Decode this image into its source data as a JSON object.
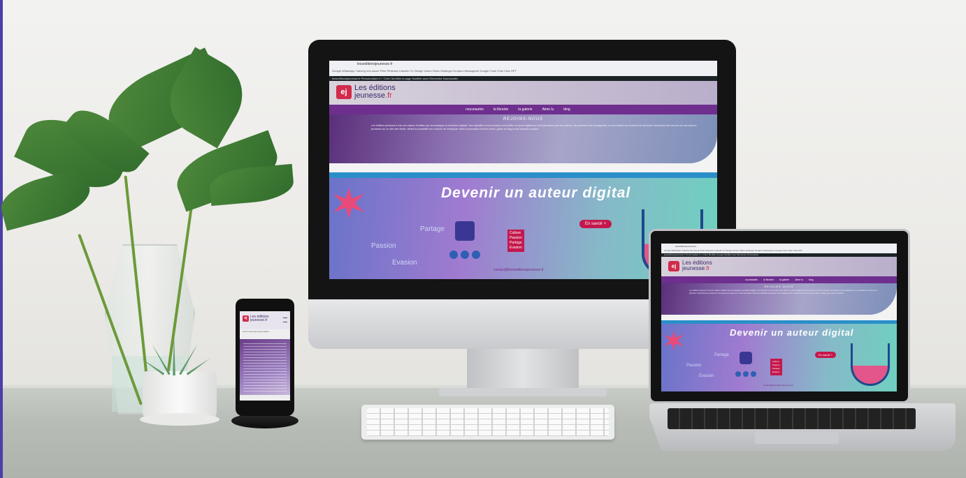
{
  "desktop_site": {
    "url": "lesseditionsjeunesse.fr",
    "bookmarks": "Google  WhatsApp  Training  Vos savoir  Pinte  Pinterest  LinkedIn  Trr Design  Vimeo Vidéo  Hostinger  Dropbox  Messagerie  Google Fonts  Todo  Chat GPT",
    "admin_bar": "lesseditionsjeunesse.fr   Personnaliser   0   +  Créer   Modifier la page   Modifier avec Elementor   Nouveautés",
    "logo_mark": "ej",
    "logo_line1": "Les éditions",
    "logo_line2": "jeunesse",
    "logo_tld": ".fr",
    "nav": [
      "nouveautés",
      "la librairie",
      "la galerie",
      "Aime lu",
      "blog"
    ],
    "section_title": "REJOINS-NOUS",
    "section_text": "Les éditions jeunesse.fr est une maison d'édition qui accompagne la révolution digitale. Nos objectifs et nos services sont d'offrir un accès digital aux livres jeunesse pour les auteurs, les parents et les enseignants, en permettant aux lecteurs de découvrir l'ensemble des œuvres de nos auteurs jeunesse sur un site web dédié, offrant la possibilité aux auteurs de s'impliquer dans la promotion de leurs livres, grâce au blog et aux réseaux sociaux.",
    "hero_title": "Devenir un auteur digital",
    "hero_button": "En savoir +",
    "hero_words": [
      "Partage",
      "Passion",
      "Evasion"
    ],
    "hero_tag": [
      "Culture",
      "Passion",
      "Partage",
      "Evasion"
    ],
    "hero_email": "contact@lesseditionsjeunesse.fr"
  },
  "phone_site": {
    "logo_mark": "ej",
    "logo_line1": "Les éditions",
    "logo_line2": "jeunesse.fr",
    "subtitle": "www.universjeunesse.digital"
  }
}
